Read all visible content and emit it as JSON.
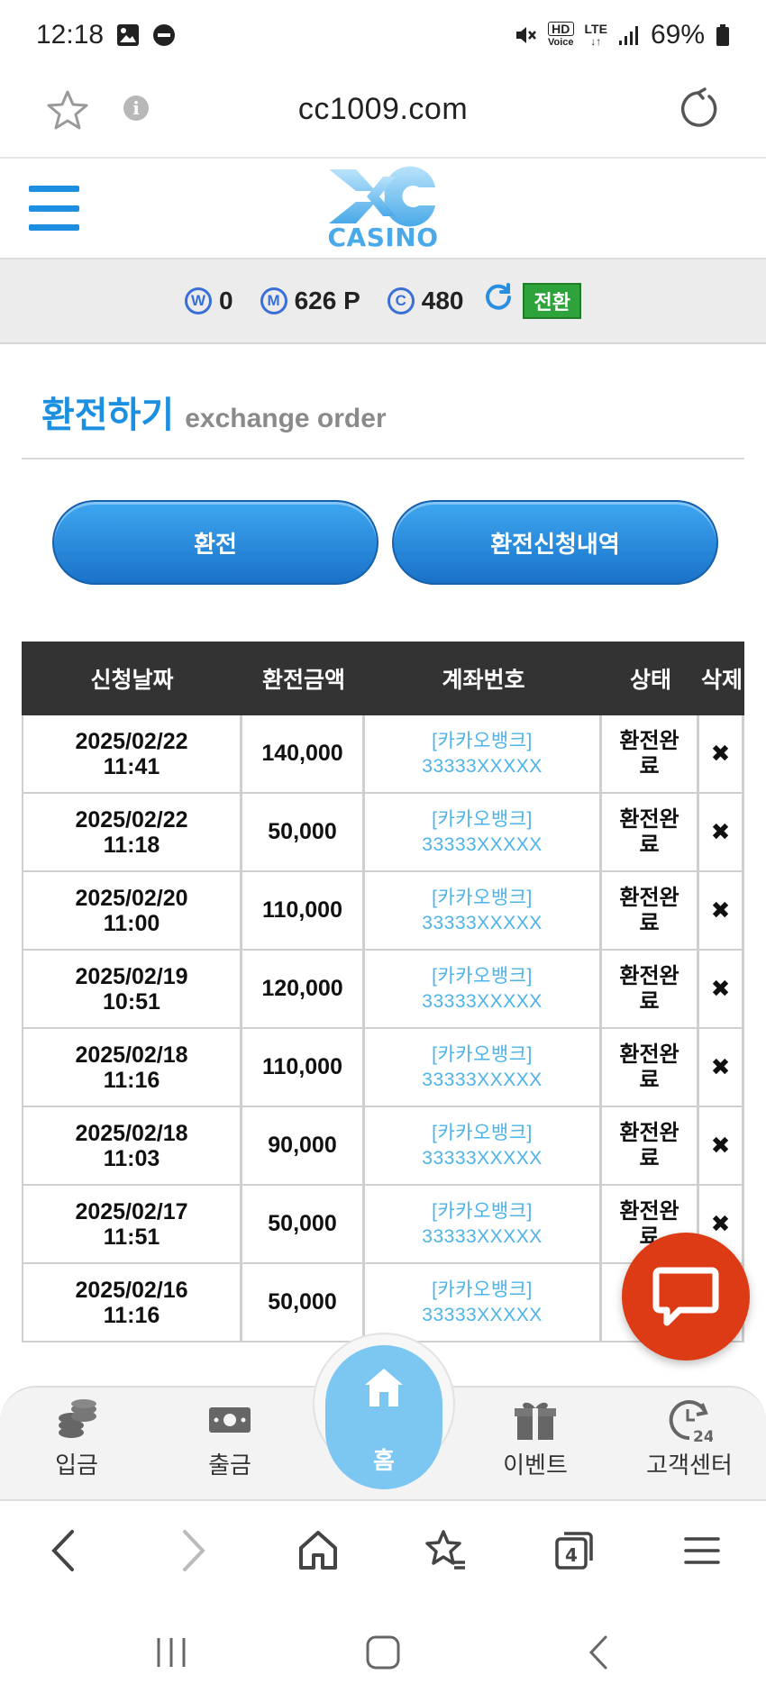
{
  "status_bar": {
    "time": "12:18",
    "hd_voice_line1": "HD",
    "hd_voice_line2": "Voice",
    "lte": "LTE",
    "battery": "69%"
  },
  "url_bar": {
    "url": "cc1009.com"
  },
  "site_header": {
    "logo_text": "CASINO"
  },
  "balance": {
    "w_badge": "W",
    "w_value": "0",
    "m_badge": "M",
    "m_value": "626 P",
    "c_badge": "C",
    "c_value": "480",
    "convert_label": "전환"
  },
  "page": {
    "title_ko": "환전하기",
    "title_en": "exchange order"
  },
  "buttons": {
    "exchange": "환전",
    "history": "환전신청내역"
  },
  "table": {
    "headers": [
      "신청날짜",
      "환전금액",
      "계좌번호",
      "상태",
      "삭제"
    ],
    "rows": [
      {
        "date": "2025/02/22",
        "time": "11:41",
        "amount": "140,000",
        "bank": "[카카오뱅크]",
        "account": "33333XXXXX",
        "status1": "환전완",
        "status2": "료",
        "delete": "✖"
      },
      {
        "date": "2025/02/22",
        "time": "11:18",
        "amount": "50,000",
        "bank": "[카카오뱅크]",
        "account": "33333XXXXX",
        "status1": "환전완",
        "status2": "료",
        "delete": "✖"
      },
      {
        "date": "2025/02/20",
        "time": "11:00",
        "amount": "110,000",
        "bank": "[카카오뱅크]",
        "account": "33333XXXXX",
        "status1": "환전완",
        "status2": "료",
        "delete": "✖"
      },
      {
        "date": "2025/02/19",
        "time": "10:51",
        "amount": "120,000",
        "bank": "[카카오뱅크]",
        "account": "33333XXXXX",
        "status1": "환전완",
        "status2": "료",
        "delete": "✖"
      },
      {
        "date": "2025/02/18",
        "time": "11:16",
        "amount": "110,000",
        "bank": "[카카오뱅크]",
        "account": "33333XXXXX",
        "status1": "환전완",
        "status2": "료",
        "delete": "✖"
      },
      {
        "date": "2025/02/18",
        "time": "11:03",
        "amount": "90,000",
        "bank": "[카카오뱅크]",
        "account": "33333XXXXX",
        "status1": "환전완",
        "status2": "료",
        "delete": "✖"
      },
      {
        "date": "2025/02/17",
        "time": "11:51",
        "amount": "50,000",
        "bank": "[카카오뱅크]",
        "account": "33333XXXXX",
        "status1": "환전완",
        "status2": "료",
        "delete": "✖"
      },
      {
        "date": "2025/02/16",
        "time": "11:16",
        "amount": "50,000",
        "bank": "[카카오뱅크]",
        "account": "33333XXXXX",
        "status1": "환",
        "status2": "",
        "delete": ""
      }
    ]
  },
  "bottom_nav": {
    "deposit": "입금",
    "withdraw": "출금",
    "home": "홈",
    "event": "이벤트",
    "support": "고객센터",
    "support_badge": "24"
  },
  "browser_bar": {
    "tab_count": "4"
  },
  "colors": {
    "accent_blue": "#1b8fe0",
    "header_dark": "#333333",
    "chat_orange": "#dd3b15",
    "account_blue": "#4db3e8",
    "convert_green": "#2fa33b"
  }
}
